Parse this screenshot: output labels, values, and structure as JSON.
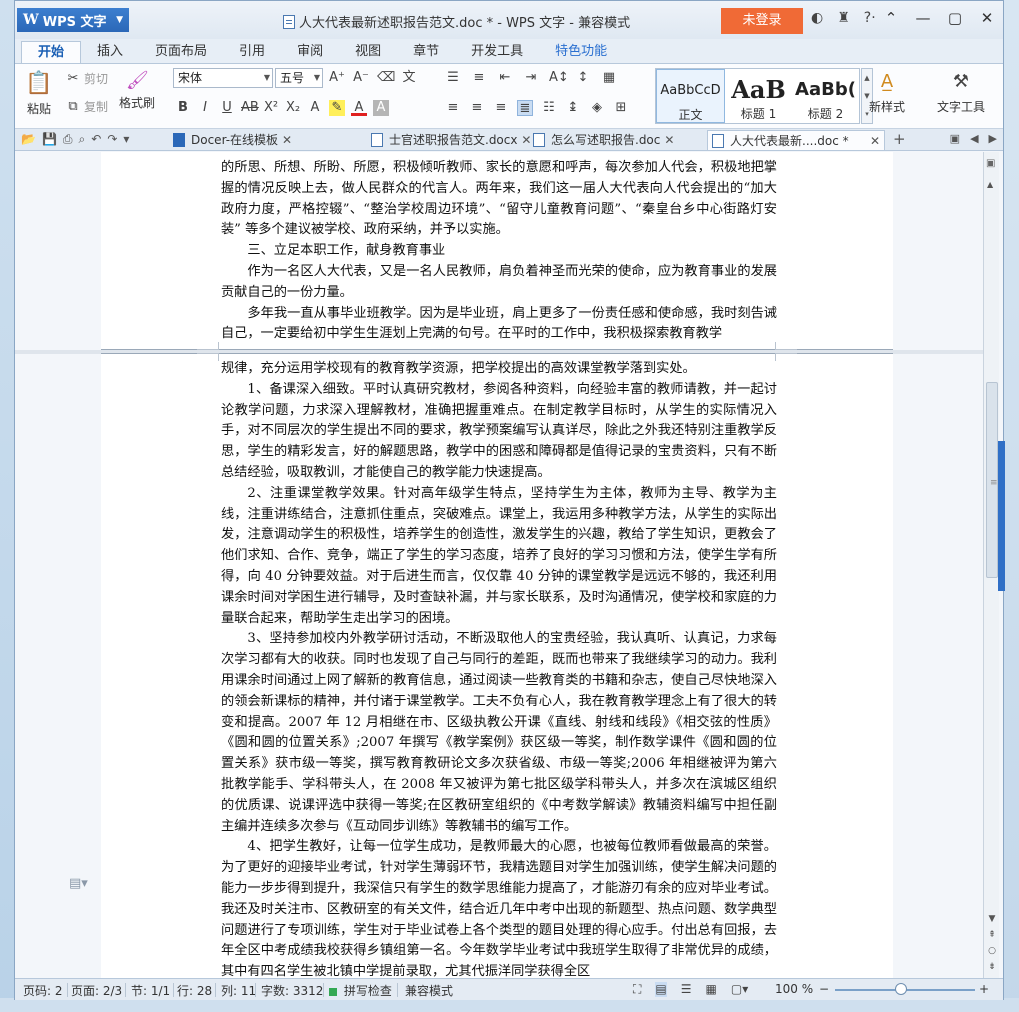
{
  "app": {
    "name": "WPS 文字",
    "window_title": "人大代表最新述职报告范文.doc * - WPS 文字 - 兼容模式",
    "login_label": "未登录"
  },
  "ribbon_tabs": [
    "开始",
    "插入",
    "页面布局",
    "引用",
    "审阅",
    "视图",
    "章节",
    "开发工具",
    "特色功能"
  ],
  "ribbon": {
    "paste": "粘贴",
    "cut": "剪切",
    "copy": "复制",
    "format_painter": "格式刷",
    "font_name": "宋体",
    "font_size": "五号",
    "styles": [
      {
        "preview": "AaBbCcD",
        "label": "正文"
      },
      {
        "preview": "AaB",
        "label": "标题 1"
      },
      {
        "preview": "AaBb(",
        "label": "标题 2"
      }
    ],
    "new_style": "新样式",
    "text_tools": "文字工具"
  },
  "doc_tabs": [
    {
      "label": "Docer-在线模板",
      "active": false
    },
    {
      "label": "士官述职报告范文.docx",
      "active": false
    },
    {
      "label": "怎么写述职报告.doc",
      "active": false
    },
    {
      "label": "人大代表最新....doc *",
      "active": true
    }
  ],
  "document": {
    "page1": [
      {
        "text": "的所思、所想、所盼、所愿，积极倾听教师、家长的意愿和呼声，每次参加人代会，积极地把掌握的情况反映上去，做人民群众的代言人。两年来，我们这一届人大代表向人代会提出的“加大政府力度，严格控辍”、“整治学校周边环境”、“留守儿童教育问题”、“秦皇台乡中心街路灯安装” 等多个建议被学校、政府采纳，并予以实施。",
        "indent": false
      },
      {
        "text": "三、立足本职工作，献身教育事业",
        "indent": true
      },
      {
        "text": "作为一名区人大代表，又是一名人民教师，肩负着神圣而光荣的使命，应为教育事业的发展贡献自己的一份力量。",
        "indent": true
      },
      {
        "text": "多年我一直从事毕业班教学。因为是毕业班，肩上更多了一份责任感和使命感，我时刻告诫自己，一定要给初中学生生涯划上完满的句号。在平时的工作中，我积极探索教育教学",
        "indent": true
      }
    ],
    "page2": [
      {
        "text": "规律，充分运用学校现有的教育教学资源，把学校提出的高效课堂教学落到实处。",
        "indent": false
      },
      {
        "text": "1、备课深入细致。平时认真研究教材，参阅各种资料，向经验丰富的教师请教，并一起讨论教学问题，力求深入理解教材，准确把握重难点。在制定教学目标时，从学生的实际情况入手，对不同层次的学生提出不同的要求，教学预案编写认真详尽，除此之外我还特别注重教学反思，学生的精彩发言，好的解题思路，教学中的困惑和障碍都是值得记录的宝贵资料，只有不断总结经验，吸取教训，才能使自己的教学能力快速提高。",
        "indent": true
      },
      {
        "text": "2、注重课堂教学效果。针对高年级学生特点，坚持学生为主体，教师为主导、教学为主线，注重讲练结合，注意抓住重点，突破难点。课堂上，我运用多种教学方法，从学生的实际出发，注意调动学生的积极性，培养学生的创造性，激发学生的兴趣，教给了学生知识，更教会了他们求知、合作、竞争，端正了学生的学习态度，培养了良好的学习习惯和方法，使学生学有所得，向 40 分钟要效益。对于后进生而言，仅仅靠 40 分钟的课堂教学是远远不够的，我还利用课余时间对学困生进行辅导，及时查缺补漏，并与家长联系，及时沟通情况，使学校和家庭的力量联合起来，帮助学生走出学习的困境。",
        "indent": true
      },
      {
        "text": "3、坚持参加校内外教学研讨活动，不断汲取他人的宝贵经验，我认真听、认真记，力求每次学习都有大的收获。同时也发现了自己与同行的差距，既而也带来了我继续学习的动力。我利用课余时间通过上网了解新的教育信息，通过阅读一些教育类的书籍和杂志，使自己尽快地深入的领会新课标的精神，并付诸于课堂教学。工夫不负有心人，我在教育教学理念上有了很大的转变和提高。2007 年 12 月相继在市、区级执教公开课《直线、射线和线段》《相交弦的性质》《圆和圆的位置关系》;2007 年撰写《教学案例》获区级一等奖，制作数学课件《圆和圆的位置关系》获市级一等奖，撰写教育教研论文多次获省级、市级一等奖;2006 年相继被评为第六批教学能手、学科带头人，在 2008 年又被评为第七批区级学科带头人，并多次在滨城区组织的优质课、说课评选中获得一等奖;在区教研室组织的《中考数学解读》教辅资料编写中担任副主编并连续多次参与《互动同步训练》等教辅书的编写工作。",
        "indent": true
      },
      {
        "text": "4、把学生教好，让每一位学生成功，是教师最大的心愿，也被每位教师看做最高的荣誉。为了更好的迎接毕业考试，针对学生薄弱环节，我精选题目对学生加强训练，使学生解决问题的能力一步步得到提升，我深信只有学生的数学思维能力提高了，才能游刃有余的应对毕业考试。我还及时关注市、区教研室的有关文件，结合近几年中考中出现的新题型、热点问题、数学典型问题进行了专项训练，学生对于毕业试卷上各个类型的题目处理的得心应手。付出总有回报，去年全区中考成绩我校获得乡镇组第一名。今年数学毕业考试中我班学生取得了非常优异的成绩，其中有四名学生被北镇中学提前录取，尤其代振洋同学获得全区",
        "indent": true
      }
    ]
  },
  "status": {
    "page_num": "页码: 2",
    "pages": "页面: 2/3",
    "section": "节: 1/1",
    "row": "行: 28",
    "col": "列: 11",
    "word_count": "字数: 3312",
    "spell_check": "拼写检查",
    "compat_mode": "兼容模式",
    "zoom": "100 %"
  },
  "colors": {
    "accent": "#2b68b8",
    "login": "#f06a36",
    "spell_ok": "#34a853"
  }
}
